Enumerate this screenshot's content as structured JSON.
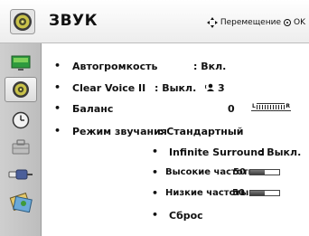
{
  "header": {
    "title": "ЗВУК",
    "nav_hint": "Перемещение",
    "ok_label": "OK"
  },
  "sidebar": {
    "items": [
      {
        "icon": "picture-icon",
        "selected": false
      },
      {
        "icon": "sound-icon",
        "selected": true
      },
      {
        "icon": "clock-icon",
        "selected": false
      },
      {
        "icon": "lock-icon",
        "selected": false
      },
      {
        "icon": "input-icon",
        "selected": false
      },
      {
        "icon": "options-icon",
        "selected": false
      }
    ]
  },
  "menu": {
    "auto_volume": {
      "label": "Автогромкость",
      "value": ": Вкл."
    },
    "clear_voice": {
      "label": "Clear Voice II",
      "value": ": Выкл.",
      "level": "3"
    },
    "balance": {
      "label": "Баланс",
      "value": "0",
      "left": "L",
      "right": "R"
    },
    "sound_mode": {
      "label": "Режим звучания",
      "value": ": Стандартный"
    },
    "infinite_surround": {
      "label": "Infinite Surround",
      "value": ": Выкл."
    },
    "treble": {
      "label": "Высокие частоты",
      "value": "50",
      "level": 0.5
    },
    "bass": {
      "label": "Низкие частоты",
      "value": "50",
      "level": 0.5
    },
    "reset": {
      "label": "Сброс"
    }
  },
  "bullet": "•"
}
